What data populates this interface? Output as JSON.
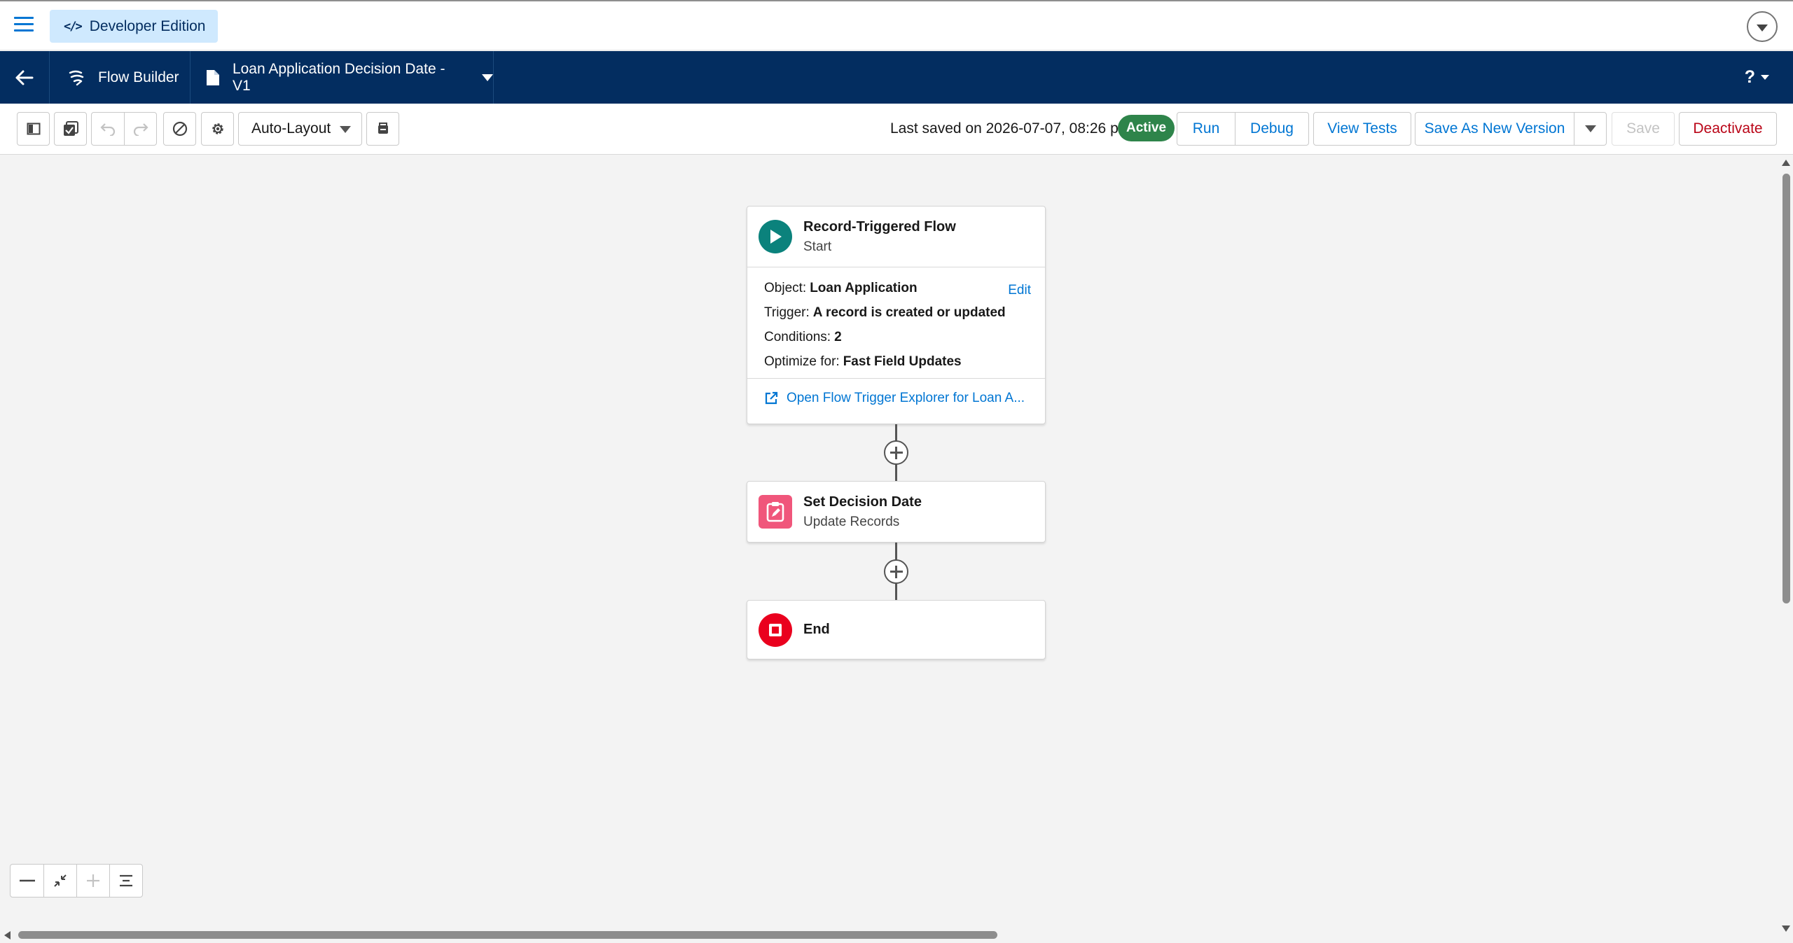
{
  "topbar": {
    "app_badge": "Developer Edition",
    "app_badge_glyph": "</>"
  },
  "nav": {
    "app_name": "Flow Builder",
    "flow_name": "Loan Application Decision Date - V1",
    "help_label": "?"
  },
  "toolbar": {
    "layout_mode": "Auto-Layout",
    "last_saved": "Last saved on 2026-07-07, 08:26 p.m.",
    "status_badge": "Active",
    "run_label": "Run",
    "debug_label": "Debug",
    "view_tests_label": "View Tests",
    "save_new_version_label": "Save As New Version",
    "save_label": "Save",
    "deactivate_label": "Deactivate"
  },
  "colors": {
    "brand_navy": "#032d60",
    "link_blue": "#0176d3",
    "active_green": "#2e844a",
    "start_teal": "#0b827c",
    "update_pink": "#f0567b",
    "end_red": "#ea001e",
    "destructive_red": "#ba0517"
  },
  "flow": {
    "start": {
      "title": "Record-Triggered Flow",
      "subtitle": "Start",
      "object_label": "Object:",
      "object_value": "Loan Application",
      "edit_label": "Edit",
      "trigger_label": "Trigger:",
      "trigger_value": "A record is created or updated",
      "conditions_label": "Conditions:",
      "conditions_value": "2",
      "optimize_label": "Optimize for:",
      "optimize_value": "Fast Field Updates",
      "explorer_link": "Open Flow Trigger Explorer for Loan A..."
    },
    "update": {
      "title": "Set Decision Date",
      "subtitle": "Update Records"
    },
    "end": {
      "title": "End"
    }
  }
}
